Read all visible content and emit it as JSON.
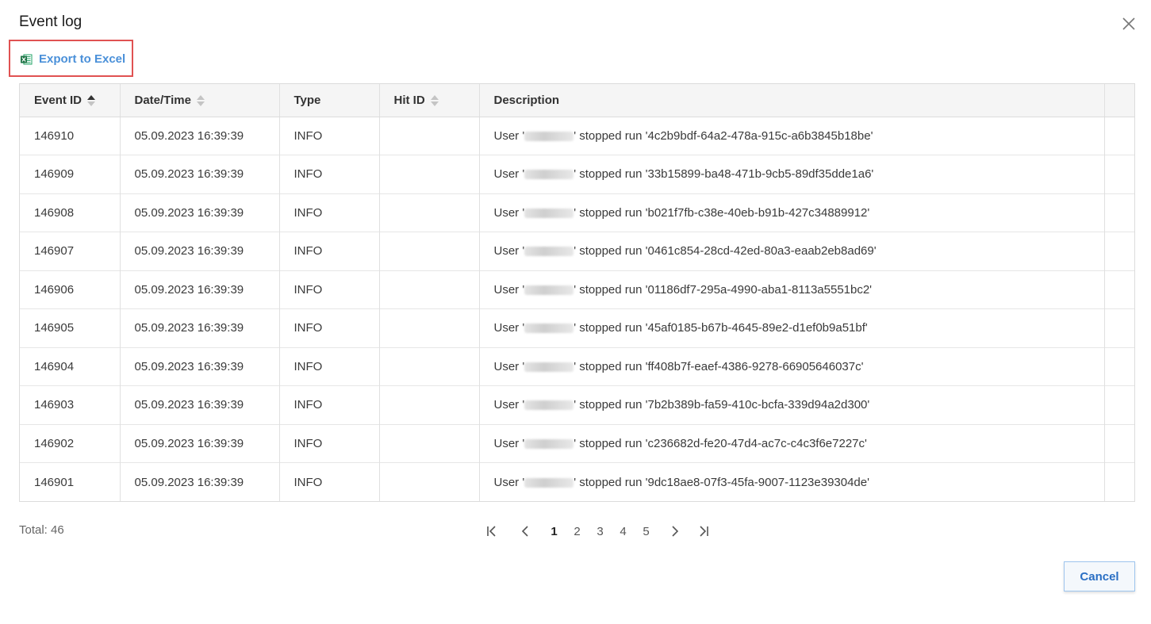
{
  "dialog": {
    "title": "Event log",
    "close_icon": "close-icon"
  },
  "toolbar": {
    "export_label": "Export to Excel",
    "export_icon": "excel-icon"
  },
  "table": {
    "columns": [
      {
        "label": "Event ID",
        "sort": "ascending"
      },
      {
        "label": "Date/Time",
        "sort": "none"
      },
      {
        "label": "Type"
      },
      {
        "label": "Hit ID",
        "sort": "none"
      },
      {
        "label": "Description"
      },
      {
        "label": ""
      }
    ],
    "rows": [
      {
        "event_id": "146910",
        "datetime": "05.09.2023 16:39:39",
        "type": "INFO",
        "hit_id": "",
        "desc_prefix": "User '",
        "desc_suffix": "' stopped run '4c2b9bdf-64a2-478a-915c-a6b3845b18be'"
      },
      {
        "event_id": "146909",
        "datetime": "05.09.2023 16:39:39",
        "type": "INFO",
        "hit_id": "",
        "desc_prefix": "User '",
        "desc_suffix": "' stopped run '33b15899-ba48-471b-9cb5-89df35dde1a6'"
      },
      {
        "event_id": "146908",
        "datetime": "05.09.2023 16:39:39",
        "type": "INFO",
        "hit_id": "",
        "desc_prefix": "User '",
        "desc_suffix": "' stopped run 'b021f7fb-c38e-40eb-b91b-427c34889912'"
      },
      {
        "event_id": "146907",
        "datetime": "05.09.2023 16:39:39",
        "type": "INFO",
        "hit_id": "",
        "desc_prefix": "User '",
        "desc_suffix": "' stopped run '0461c854-28cd-42ed-80a3-eaab2eb8ad69'"
      },
      {
        "event_id": "146906",
        "datetime": "05.09.2023 16:39:39",
        "type": "INFO",
        "hit_id": "",
        "desc_prefix": "User '",
        "desc_suffix": "' stopped run '01186df7-295a-4990-aba1-8113a5551bc2'"
      },
      {
        "event_id": "146905",
        "datetime": "05.09.2023 16:39:39",
        "type": "INFO",
        "hit_id": "",
        "desc_prefix": "User '",
        "desc_suffix": "' stopped run '45af0185-b67b-4645-89e2-d1ef0b9a51bf'"
      },
      {
        "event_id": "146904",
        "datetime": "05.09.2023 16:39:39",
        "type": "INFO",
        "hit_id": "",
        "desc_prefix": "User '",
        "desc_suffix": "' stopped run 'ff408b7f-eaef-4386-9278-66905646037c'"
      },
      {
        "event_id": "146903",
        "datetime": "05.09.2023 16:39:39",
        "type": "INFO",
        "hit_id": "",
        "desc_prefix": "User '",
        "desc_suffix": "' stopped run '7b2b389b-fa59-410c-bcfa-339d94a2d300'"
      },
      {
        "event_id": "146902",
        "datetime": "05.09.2023 16:39:39",
        "type": "INFO",
        "hit_id": "",
        "desc_prefix": "User '",
        "desc_suffix": "' stopped run 'c236682d-fe20-47d4-ac7c-c4c3f6e7227c'"
      },
      {
        "event_id": "146901",
        "datetime": "05.09.2023 16:39:39",
        "type": "INFO",
        "hit_id": "",
        "desc_prefix": "User '",
        "desc_suffix": "' stopped run '9dc18ae8-07f3-45fa-9007-1123e39304de'"
      }
    ]
  },
  "footer": {
    "total_label": "Total: 46",
    "pager": {
      "pages": [
        "1",
        "2",
        "3",
        "4",
        "5"
      ],
      "current": "1",
      "first_icon": "first-page-icon",
      "prev_icon": "chevron-left-icon",
      "next_icon": "chevron-right-icon",
      "last_icon": "last-page-icon"
    },
    "cancel_label": "Cancel"
  },
  "colors": {
    "accent": "#4a90d9",
    "highlight_border": "#e05252",
    "header_bg": "#f5f5f5",
    "cancel_text": "#2a6fc4"
  }
}
